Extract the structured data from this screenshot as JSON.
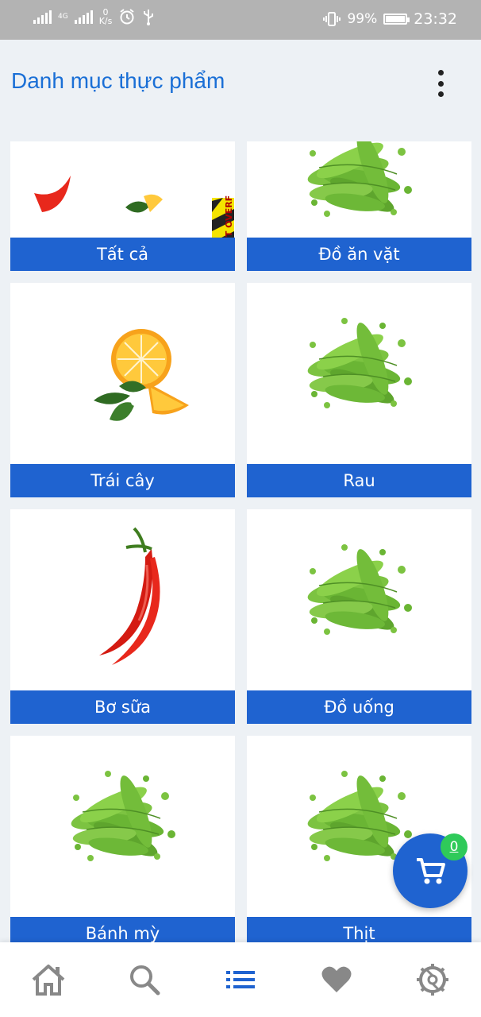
{
  "status_bar": {
    "net_speed_value": "0",
    "net_speed_unit": "K/s",
    "network_type": "4G",
    "battery": "99%",
    "time": "23:32"
  },
  "app_bar": {
    "title": "Danh mục thực phẩm",
    "menu_icon": "more-vert-icon"
  },
  "categories": [
    {
      "label": "Tất cả",
      "image": "chili-lemon-image"
    },
    {
      "label": "Đồ ăn vặt",
      "image": "snow-peas-image"
    },
    {
      "label": "Trái cây",
      "image": "orange-slices-image"
    },
    {
      "label": "Rau",
      "image": "snow-peas-image"
    },
    {
      "label": "Bơ sữa",
      "image": "red-chili-image"
    },
    {
      "label": "Đồ uống",
      "image": "snow-peas-image"
    },
    {
      "label": "Bánh mỳ",
      "image": "snow-peas-image"
    },
    {
      "label": "Thịt",
      "image": "snow-peas-image"
    }
  ],
  "overflow_warning": "RIGHT OVERF",
  "cart": {
    "count": "0",
    "icon": "cart-icon"
  },
  "bottom_nav": [
    {
      "name": "home",
      "icon": "home-icon",
      "active": false
    },
    {
      "name": "search",
      "icon": "search-icon",
      "active": false
    },
    {
      "name": "categories",
      "icon": "list-icon",
      "active": true
    },
    {
      "name": "favorites",
      "icon": "heart-icon",
      "active": false
    },
    {
      "name": "settings",
      "icon": "settings-icon",
      "active": false
    }
  ],
  "colors": {
    "primary": "#1f63d0",
    "title": "#1a6fd6",
    "badge": "#2fca5a",
    "background": "#edf1f5",
    "status_bar": "#b3b3b3"
  }
}
